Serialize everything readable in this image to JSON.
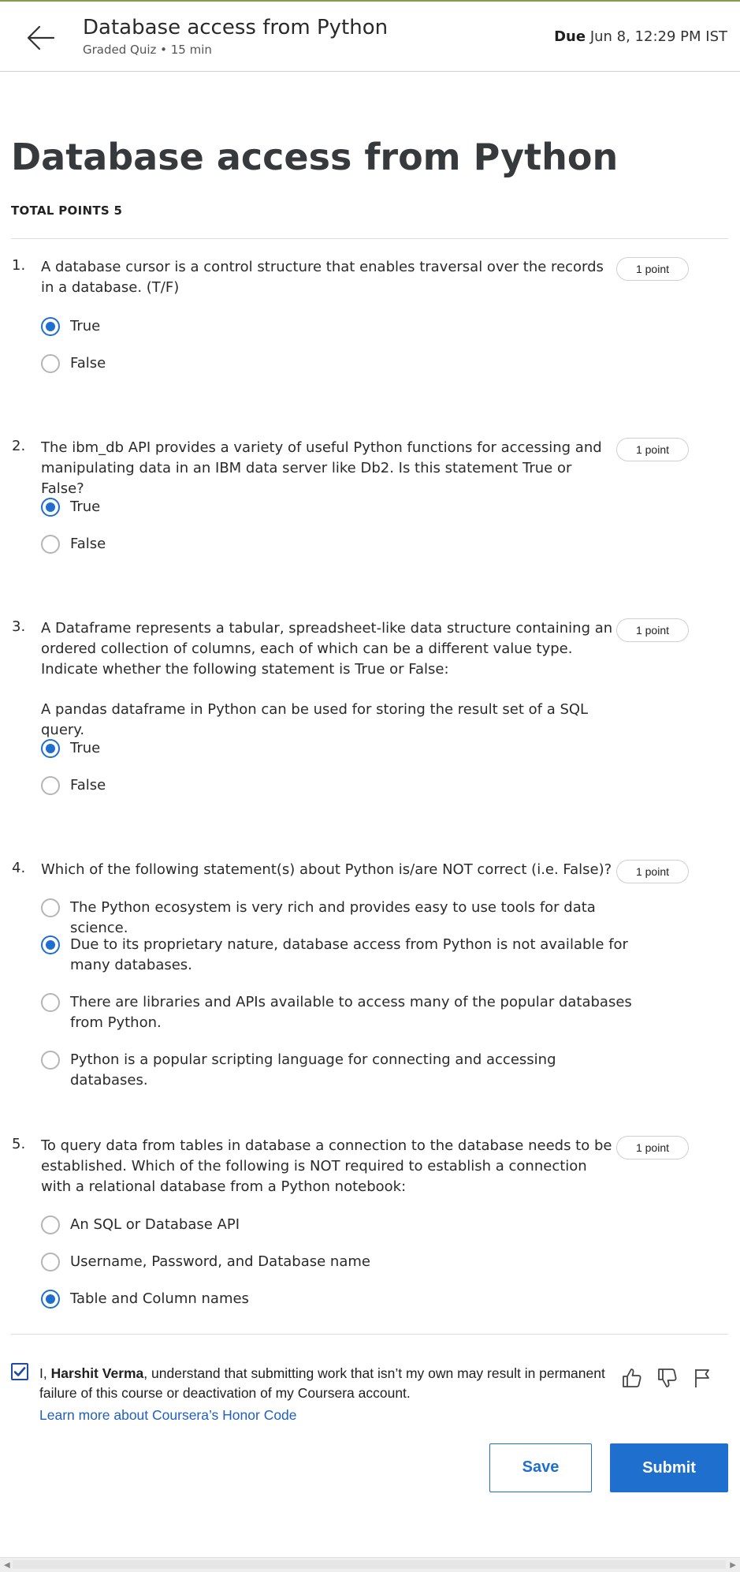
{
  "header": {
    "title": "Database access from Python",
    "subtitle": "Graded Quiz • 15 min",
    "due_label": "Due",
    "due_value": "Jun 8, 12:29 PM IST"
  },
  "main": {
    "title": "Database access from Python",
    "total_points": "TOTAL POINTS 5"
  },
  "questions": [
    {
      "number": "1.",
      "text": "A database cursor is a control structure that enables traversal over the records in a database. (T/F)",
      "points": "1 point",
      "options": [
        {
          "label": "True",
          "selected": true
        },
        {
          "label": "False",
          "selected": false
        }
      ]
    },
    {
      "number": "2.",
      "text": "The ibm_db API provides a variety of useful Python functions for accessing and manipulating data in an IBM data server like Db2. Is this statement True or False?",
      "points": "1 point",
      "options": [
        {
          "label": "True",
          "selected": true
        },
        {
          "label": "False",
          "selected": false
        }
      ]
    },
    {
      "number": "3.",
      "text": "A Dataframe represents a tabular, spreadsheet-like data structure containing an ordered collection of columns, each of which can be a different value type. Indicate whether the following statement is True or False:",
      "text2": "A pandas dataframe in Python can be used for storing the result set of a SQL query.",
      "points": "1 point",
      "options": [
        {
          "label": "True",
          "selected": true
        },
        {
          "label": "False",
          "selected": false
        }
      ]
    },
    {
      "number": "4.",
      "text": "Which of the following statement(s) about Python is/are NOT correct (i.e. False)?",
      "points": "1 point",
      "options": [
        {
          "label": "The Python ecosystem is very rich and provides easy to use tools for data science.",
          "selected": false
        },
        {
          "label": "Due to its proprietary nature, database access from Python is not available for many databases.",
          "selected": true
        },
        {
          "label": "There are libraries and APIs available to access many of the popular databases from Python.",
          "selected": false
        },
        {
          "label": "Python is a popular scripting language for connecting and accessing databases.",
          "selected": false
        }
      ]
    },
    {
      "number": "5.",
      "text": "To query data from tables in database a connection to the database needs to be established. Which of the following is NOT required to establish a connection with a relational database from a Python notebook:",
      "points": "1 point",
      "options": [
        {
          "label": "An SQL or Database API",
          "selected": false
        },
        {
          "label": "Username, Password, and Database name",
          "selected": false
        },
        {
          "label": "Table and Column names",
          "selected": true
        }
      ]
    }
  ],
  "honor": {
    "checked": true,
    "prefix": "I, ",
    "name": "Harshit Verma",
    "suffix": ", understand that submitting work that isn’t my own may result in permanent failure of this course or deactivation of my Coursera account.",
    "link": "Learn more about Coursera’s Honor Code"
  },
  "actions": {
    "save": "Save",
    "submit": "Submit"
  },
  "colors": {
    "accent": "#1f6fce",
    "link": "#1f5fbf"
  },
  "icons": [
    "arrow-left-icon",
    "thumbs-up-icon",
    "thumbs-down-icon",
    "flag-icon",
    "checkmark-icon"
  ]
}
